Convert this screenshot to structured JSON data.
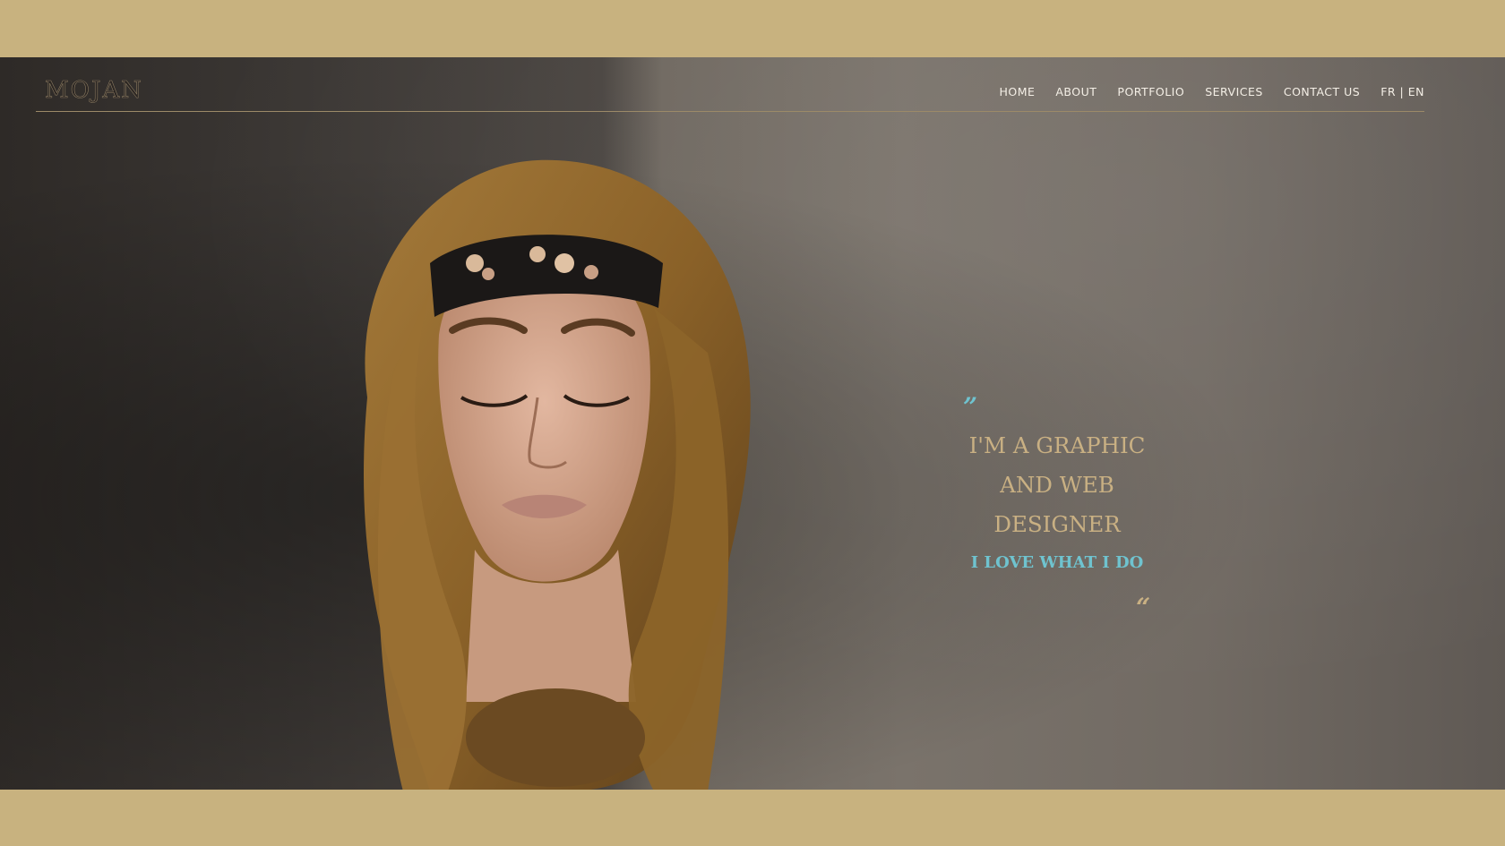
{
  "brand": {
    "logo": "MOJAN",
    "accent_gold": "#c8b27f",
    "accent_teal": "#6fc3cf"
  },
  "nav": {
    "items": [
      "HOME",
      "ABOUT",
      "PORTFOLIO",
      "SERVICES",
      "CONTACT US",
      "FR | EN"
    ]
  },
  "hero": {
    "quote_open": "”",
    "headline_lines": [
      "I'M A GRAPHIC",
      "AND WEB",
      "DESIGNER"
    ],
    "tagline": "I LOVE WHAT I DO",
    "quote_close": "“"
  }
}
